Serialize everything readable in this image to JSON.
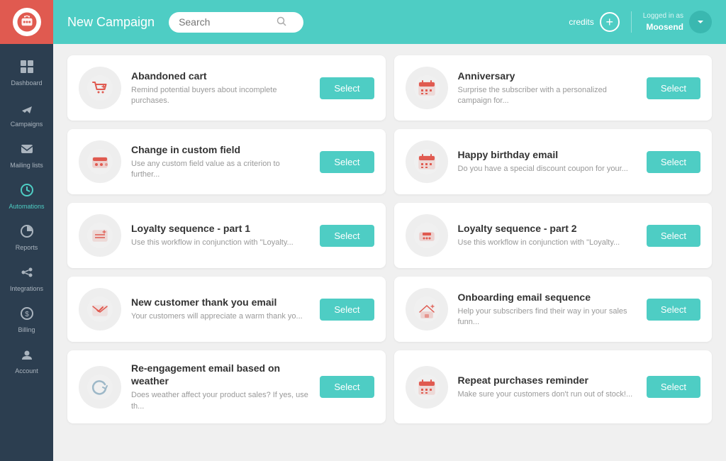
{
  "sidebar": {
    "nav_items": [
      {
        "id": "dashboard",
        "label": "Dashboard",
        "icon": "dashboard",
        "active": false
      },
      {
        "id": "campaigns",
        "label": "Campaigns",
        "icon": "campaigns",
        "active": false
      },
      {
        "id": "mailing-lists",
        "label": "Mailing lists",
        "icon": "mailing",
        "active": false
      },
      {
        "id": "automations",
        "label": "Automations",
        "icon": "automations",
        "active": true
      },
      {
        "id": "reports",
        "label": "Reports",
        "icon": "reports",
        "active": false
      },
      {
        "id": "integrations",
        "label": "Integrations",
        "icon": "integrations",
        "active": false
      },
      {
        "id": "billing",
        "label": "Billing",
        "icon": "billing",
        "active": false
      },
      {
        "id": "account",
        "label": "Account",
        "icon": "account",
        "active": false
      }
    ]
  },
  "topbar": {
    "title": "New Campaign",
    "search_placeholder": "Search",
    "credits_label": "credits",
    "logged_in_as_label": "Logged in as",
    "username": "Moosend"
  },
  "campaigns": [
    {
      "id": "abandoned-cart",
      "title": "Abandoned cart",
      "description": "Remind potential buyers about incomplete purchases.",
      "icon_type": "cart",
      "select_label": "Select"
    },
    {
      "id": "anniversary",
      "title": "Anniversary",
      "description": "Surprise the subscriber with a personalized campaign for...",
      "icon_type": "calendar",
      "select_label": "Select"
    },
    {
      "id": "change-custom-field",
      "title": "Change in custom field",
      "description": "Use any custom field value as a criterion to further...",
      "icon_type": "custom-field",
      "select_label": "Select"
    },
    {
      "id": "happy-birthday",
      "title": "Happy birthday email",
      "description": "Do you have a special discount coupon for your...",
      "icon_type": "calendar",
      "select_label": "Select"
    },
    {
      "id": "loyalty-1",
      "title": "Loyalty sequence - part 1",
      "description": "Use this workflow in conjunction with \"Loyalty...",
      "icon_type": "loyalty1",
      "select_label": "Select"
    },
    {
      "id": "loyalty-2",
      "title": "Loyalty sequence - part 2",
      "description": "Use this workflow in conjunction with \"Loyalty...",
      "icon_type": "loyalty2",
      "select_label": "Select"
    },
    {
      "id": "new-customer-thank-you",
      "title": "New customer thank you email",
      "description": "Your customers will appreciate a warm thank yo...",
      "icon_type": "thank-you",
      "select_label": "Select"
    },
    {
      "id": "onboarding",
      "title": "Onboarding email sequence",
      "description": "Help your subscribers find their way in your sales funn...",
      "icon_type": "onboarding",
      "select_label": "Select"
    },
    {
      "id": "reengagement-weather",
      "title": "Re-engagement email based on weather",
      "description": "Does weather affect your product sales? If yes, use th...",
      "icon_type": "reengagement",
      "select_label": "Select"
    },
    {
      "id": "repeat-purchases",
      "title": "Repeat purchases reminder",
      "description": "Make sure your customers don't run out of stock!...",
      "icon_type": "calendar",
      "select_label": "Select"
    }
  ]
}
